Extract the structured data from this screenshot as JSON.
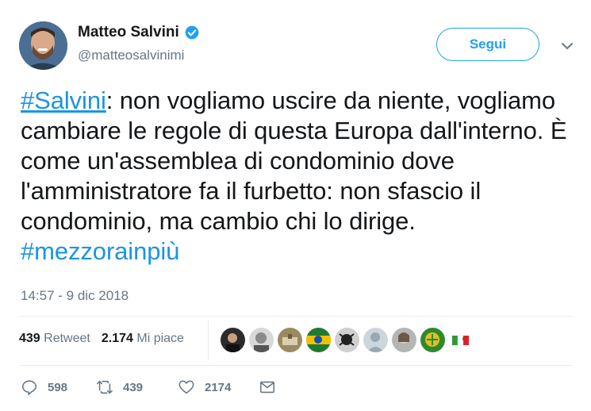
{
  "user": {
    "name": "Matteo Salvini",
    "handle": "@matteosalvinimi"
  },
  "follow_label": "Segui",
  "tweet": {
    "hashtag1": "#Salvini",
    "body": ": non vogliamo uscire da niente, vogliamo cambiare le regole di questa Europa dall'interno. È come un'assemblea di condominio dove l'amministratore fa il furbetto: non sfascio il condominio, ma cambio chi lo dirige. ",
    "hashtag2": "#mezzorainpiù"
  },
  "timestamp": "14:57 - 9 dic 2018",
  "stats": {
    "retweets_count": "439",
    "retweets_label": "Retweet",
    "likes_count": "2.174",
    "likes_label": "Mi piace"
  },
  "actions": {
    "replies": "598",
    "retweets": "439",
    "likes": "2174"
  },
  "colors": {
    "accent": "#1da1f2",
    "link": "#1b95e0",
    "muted": "#657786"
  },
  "icons": [
    "verified-icon",
    "chevron-down-icon",
    "reply-icon",
    "retweet-icon",
    "heart-icon",
    "message-icon"
  ]
}
